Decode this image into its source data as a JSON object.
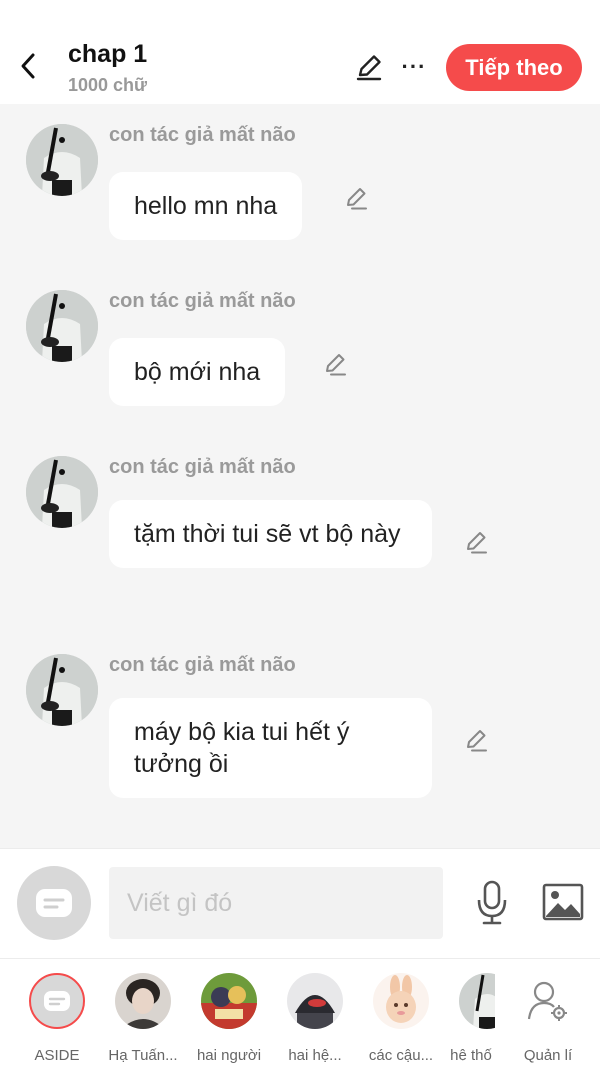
{
  "header": {
    "title": "chap 1",
    "subtitle": "1000 chữ",
    "next_label": "Tiếp theo",
    "more_label": "···"
  },
  "messages": [
    {
      "author": "con tác giả mất não",
      "text": "hello mn nha"
    },
    {
      "author": "con tác giả mất não",
      "text": "bộ mới nha"
    },
    {
      "author": "con tác giả mất não",
      "text": "tặm thời tui sẽ vt bộ này"
    },
    {
      "author": "con tác giả mất não",
      "text": "máy bộ kia tui hết ý tưởng ồi"
    }
  ],
  "input": {
    "placeholder": "Viết gì đó"
  },
  "bottom_tabs": [
    {
      "label": "ASIDE",
      "icon": "aside-icon",
      "active": true
    },
    {
      "label": "Hạ Tuấn...",
      "icon": "avatar"
    },
    {
      "label": "hai người",
      "icon": "avatar"
    },
    {
      "label": "hai hệ...",
      "icon": "avatar"
    },
    {
      "label": "các cậu...",
      "icon": "avatar"
    },
    {
      "label": "hệ thố",
      "icon": "avatar"
    },
    {
      "label": "Quản lí",
      "icon": "manage-icon"
    }
  ],
  "colors": {
    "accent": "#f54b4b",
    "background": "#f5f5f5",
    "muted": "#9a9a9a"
  }
}
